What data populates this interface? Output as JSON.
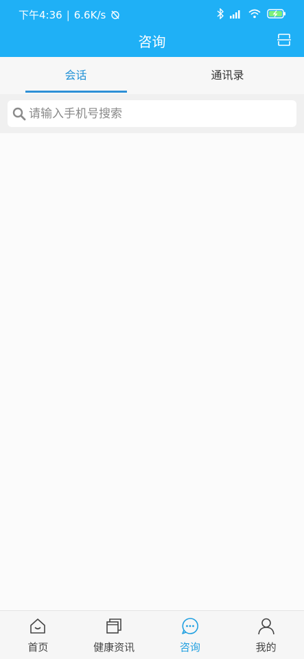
{
  "status_bar": {
    "time": "下午4:36",
    "speed": "6.6K/s"
  },
  "header": {
    "title": "咨询"
  },
  "tabs": [
    {
      "label": "会话",
      "active": true
    },
    {
      "label": "通讯录",
      "active": false
    }
  ],
  "search": {
    "placeholder": "请输入手机号搜索",
    "value": ""
  },
  "bottom_nav": [
    {
      "label": "首页",
      "icon": "home-icon"
    },
    {
      "label": "健康资讯",
      "icon": "news-icon"
    },
    {
      "label": "咨询",
      "icon": "chat-icon",
      "active": true
    },
    {
      "label": "我的",
      "icon": "person-icon"
    }
  ],
  "colors": {
    "header": "#1fb0f6",
    "active_tab": "#1f90d6",
    "active_nav": "#1f9fe0"
  }
}
